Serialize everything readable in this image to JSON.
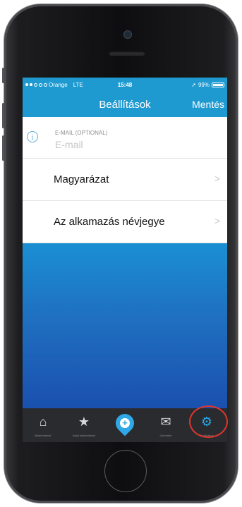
{
  "status_bar": {
    "carrier": "Orange",
    "network": "LTE",
    "time": "15:48",
    "battery": "99%",
    "battery_level": 0.99
  },
  "nav": {
    "title": "Beállítások",
    "action": "Mentés"
  },
  "email": {
    "label": "E-MAIL (OPTIONAL)",
    "placeholder": "E-mail",
    "value": ""
  },
  "list": [
    {
      "label": "Magyarázat"
    },
    {
      "label": "Az alkamazás névjegye"
    }
  ],
  "tabs": [
    {
      "label": "Bejelentések",
      "icon": "home-icon"
    },
    {
      "label": "Saját bejelentések",
      "icon": "star-icon"
    },
    {
      "label": "",
      "icon": "add-pin-icon"
    },
    {
      "label": "Üzenetek",
      "icon": "mail-icon"
    },
    {
      "label": "Beállítások",
      "icon": "gear-icon"
    }
  ],
  "colors": {
    "accent": "#1f9ad1",
    "tab_active": "#2fa8e8",
    "highlight": "#e0362c"
  }
}
